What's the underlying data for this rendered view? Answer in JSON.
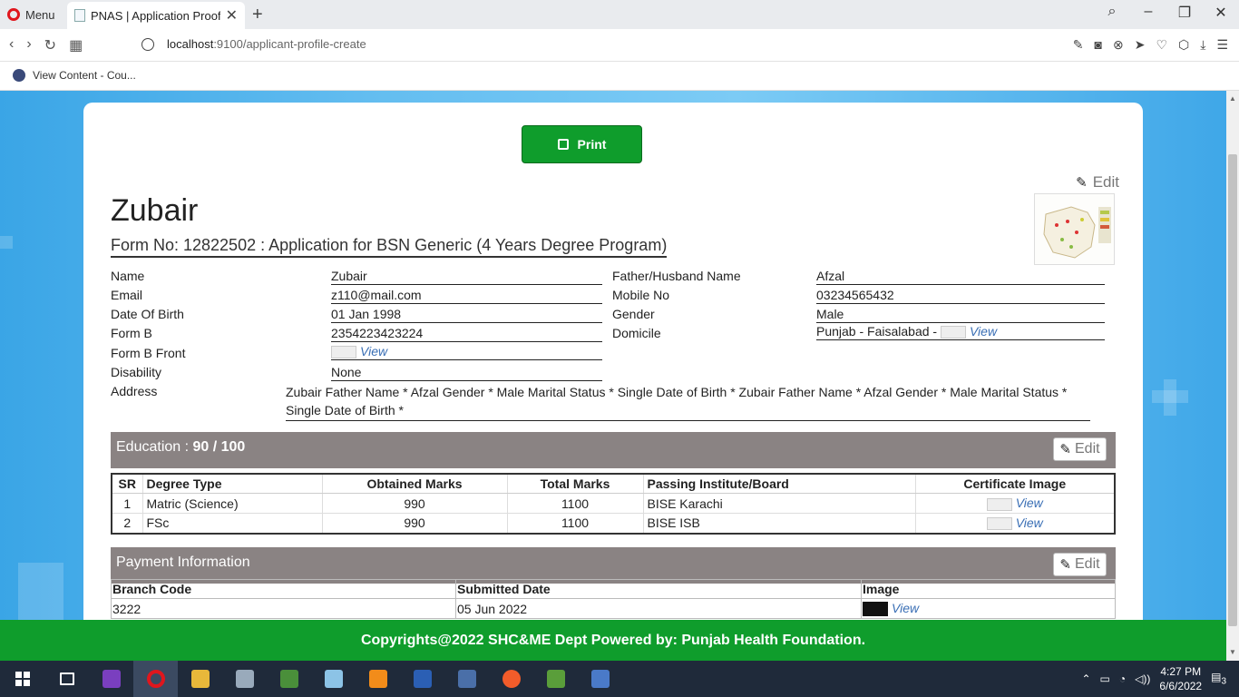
{
  "browser": {
    "menu_label": "Menu",
    "tab_title": "PNAS | Application Proof R",
    "url_host": "localhost",
    "url_path": ":9100/applicant-profile-create",
    "bookmark": "View Content - Cou..."
  },
  "page": {
    "print_label": "Print",
    "edit_label": "Edit",
    "applicant_name": "Zubair",
    "form_title": "Form No: 12822502 : Application for BSN Generic (4 Years Degree Program)"
  },
  "profile": {
    "labels": {
      "name": "Name",
      "email": "Email",
      "dob": "Date Of Birth",
      "formb": "Form B",
      "formb_front": "Form B Front",
      "disability": "Disability",
      "address": "Address",
      "father": "Father/Husband Name",
      "mobile": "Mobile No",
      "gender": "Gender",
      "domicile": "Domicile"
    },
    "values": {
      "name": "Zubair",
      "email": "z110@mail.com",
      "dob": "01 Jan 1998",
      "formb": "2354223423224",
      "formb_front_view": "View",
      "disability": "None",
      "address": "Zubair Father Name * Afzal Gender * Male Marital Status * Single Date of Birth * Zubair Father Name * Afzal Gender * Male Marital Status * Single Date of Birth *",
      "father": "Afzal",
      "mobile": "03234565432",
      "gender": "Male",
      "domicile": "Punjab - Faisalabad -",
      "domicile_view": "View"
    }
  },
  "education": {
    "title": "Education : ",
    "score": "90 / 100",
    "edit_label": "Edit",
    "headers": [
      "SR",
      "Degree Type",
      "Obtained Marks",
      "Total Marks",
      "Passing Institute/Board",
      "Certificate Image"
    ],
    "rows": [
      {
        "sr": "1",
        "degree": "Matric (Science)",
        "obtained": "990",
        "total": "1100",
        "board": "BISE Karachi",
        "view": "View"
      },
      {
        "sr": "2",
        "degree": "FSc",
        "obtained": "990",
        "total": "1100",
        "board": "BISE ISB",
        "view": "View"
      }
    ]
  },
  "payment": {
    "title": "Payment Information",
    "edit_label": "Edit",
    "headers": [
      "Branch Code",
      "Submitted Date",
      "Image"
    ],
    "row": {
      "branch": "3222",
      "date": "05 Jun 2022",
      "view": "View"
    }
  },
  "footer": {
    "text": "Copyrights@2022 SHC&ME Dept Powered by: Punjab Health Foundation."
  },
  "taskbar": {
    "time": "4:27 PM",
    "date": "6/6/2022",
    "notifications": "3"
  },
  "colors": {
    "green": "#0f9d2c",
    "section_gray": "#8a8383",
    "link_blue": "#3a6fb5"
  }
}
